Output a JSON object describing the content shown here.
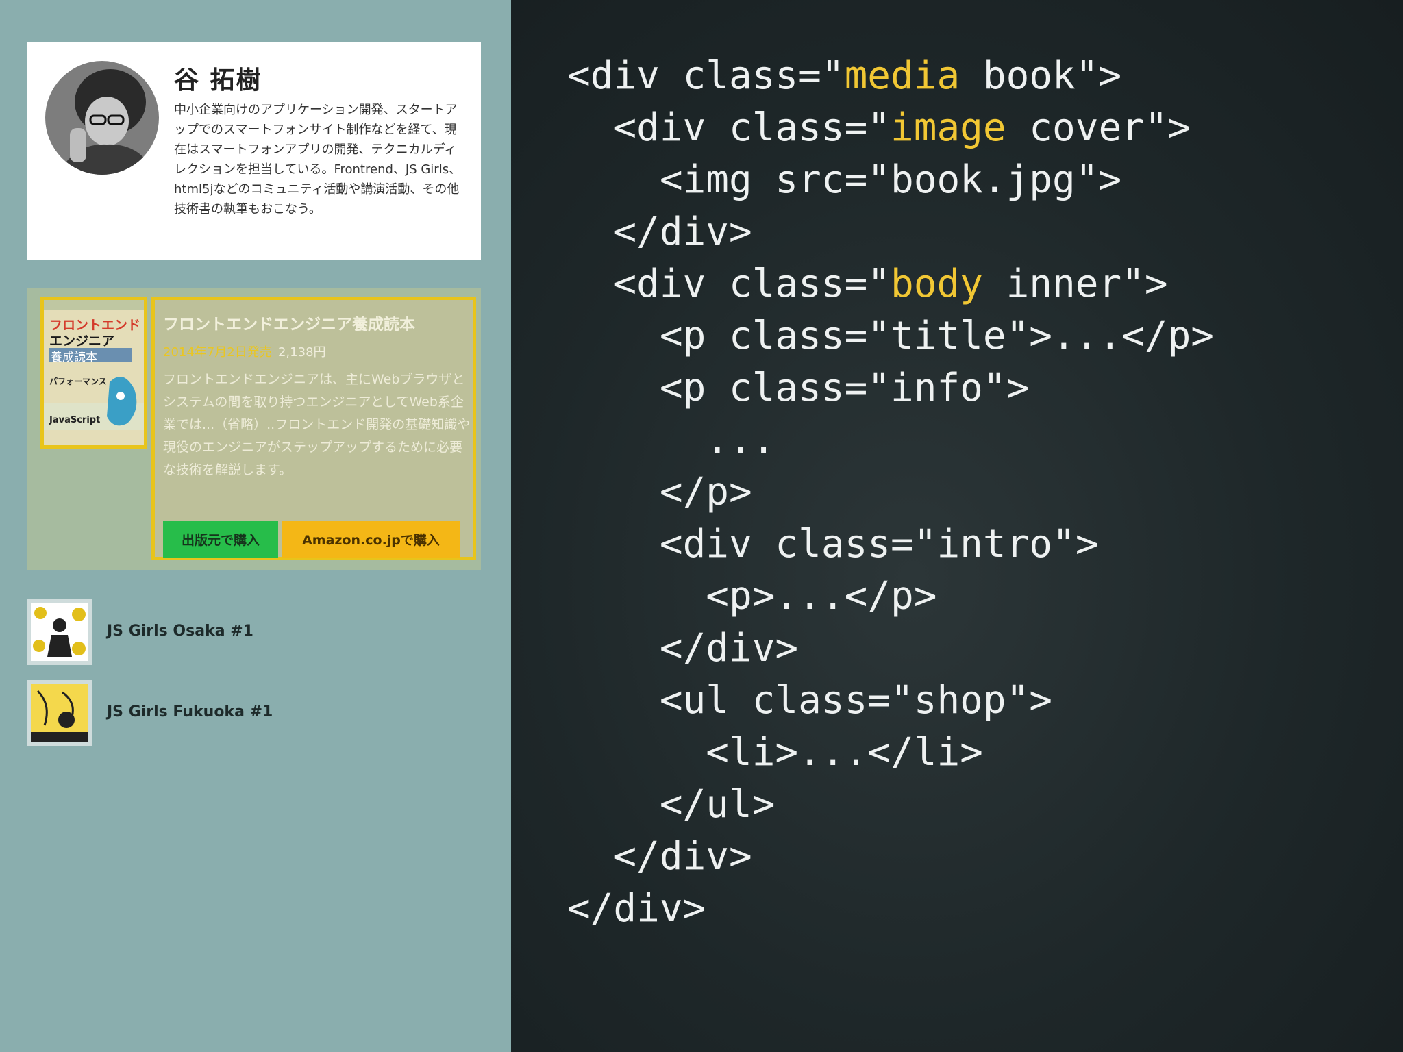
{
  "profile": {
    "name": "谷 拓樹",
    "bio": "中小企業向けのアプリケーション開発、スタートアップでのスマートフォンサイト制作などを経て、現在はスマートフォンアプリの開発、テクニカルディレクションを担当している。Frontrend、JS Girls、html5jなどのコミュニティ活動や講演活動、その他技術書の執筆もおこなう。"
  },
  "book": {
    "cover_text": {
      "line1": "フロントエンド",
      "line2": "エンジニア",
      "line3": "養成読本",
      "line4": "パフォーマンス",
      "line5": "JavaScript"
    },
    "title": "フロントエンドエンジニア養成読本",
    "date": "2014年7月2日発売",
    "price": "2,138円",
    "intro": "フロントエンドエンジニアは、主にWebブラウザとシステムの間を取り持つエンジニアとしてWeb系企業では...（省略）..フロントエンド開発の基礎知識や現役のエンジニアがステップアップするために必要な技術を解説します。",
    "shop": [
      {
        "label": "出版元で購入"
      },
      {
        "label": "Amazon.co.jpで購入"
      }
    ]
  },
  "events": [
    {
      "label": "JS Girls Osaka #1"
    },
    {
      "label": "JS Girls Fukuoka #1"
    }
  ],
  "code": {
    "l1a": "<div class=\"",
    "l1b": "media",
    "l1c": " book\">",
    "l2a": "  <div class=\"",
    "l2b": "image",
    "l2c": " cover\">",
    "l3": "    <img src=\"book.jpg\">",
    "l4": "  </div>",
    "l5a": "  <div class=\"",
    "l5b": "body",
    "l5c": " inner\">",
    "l6": "    <p class=\"title\">...</p>",
    "l7": "    <p class=\"info\">",
    "l8": "      ...",
    "l9": "    </p>",
    "l10": "    <div class=\"intro\">",
    "l11": "      <p>...</p>",
    "l12": "    </div>",
    "l13": "    <ul class=\"shop\">",
    "l14": "      <li>...</li>",
    "l15": "    </ul>",
    "l16": "  </div>",
    "l17": "</div>"
  },
  "colors": {
    "left_bg": "#8aaeae",
    "right_bg": "#1e2729",
    "highlight": "#f1c734",
    "frame": "#e8c41b",
    "publisher_button": "#27bd4a",
    "amazon_button": "#f4b716"
  }
}
